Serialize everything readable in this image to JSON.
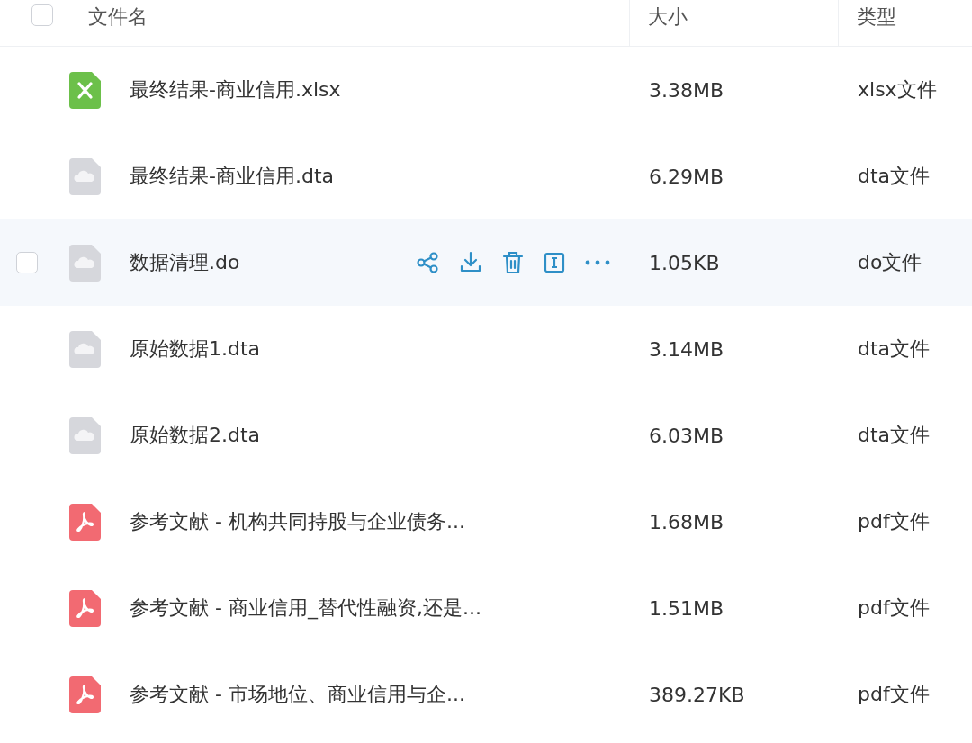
{
  "header": {
    "checkbox": {
      "checked": false
    },
    "columns": [
      "文件名",
      "大小",
      "类型"
    ]
  },
  "rows": [
    {
      "kind": "xlsx",
      "name": "最终结果-商业信用.xlsx",
      "size": "3.38MB",
      "type": "xlsx文件",
      "hovered": false
    },
    {
      "kind": "cloud",
      "name": "最终结果-商业信用.dta",
      "size": "6.29MB",
      "type": "dta文件",
      "hovered": false
    },
    {
      "kind": "cloud",
      "name": "数据清理.do",
      "size": "1.05KB",
      "type": "do文件",
      "hovered": true,
      "checked": false,
      "actions": [
        {
          "kind": "share"
        },
        {
          "kind": "download"
        },
        {
          "kind": "delete"
        },
        {
          "kind": "rename"
        },
        {
          "kind": "more"
        }
      ]
    },
    {
      "kind": "cloud",
      "name": "原始数据1.dta",
      "size": "3.14MB",
      "type": "dta文件",
      "hovered": false
    },
    {
      "kind": "cloud",
      "name": "原始数据2.dta",
      "size": "6.03MB",
      "type": "dta文件",
      "hovered": false
    },
    {
      "kind": "pdf",
      "name": "参考文献 - 机构共同持股与企业债务...",
      "size": "1.68MB",
      "type": "pdf文件",
      "hovered": false
    },
    {
      "kind": "pdf",
      "name": "参考文献 - 商业信用_替代性融资,还是...",
      "size": "1.51MB",
      "type": "pdf文件",
      "hovered": false
    },
    {
      "kind": "pdf",
      "name": "参考文献 - 市场地位、商业信用与企...",
      "size": "389.27KB",
      "type": "pdf文件",
      "hovered": false
    }
  ]
}
